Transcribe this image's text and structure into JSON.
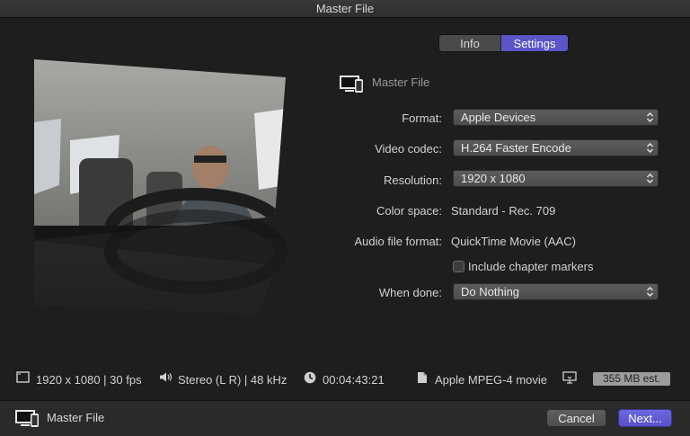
{
  "window": {
    "title": "Master File"
  },
  "tabs": [
    {
      "label": "Info",
      "selected": false
    },
    {
      "label": "Settings",
      "selected": true
    }
  ],
  "header": {
    "icon": "computer-and-phone-icon",
    "title": "Master File"
  },
  "settings": {
    "format": {
      "label": "Format:",
      "value": "Apple Devices"
    },
    "video_codec": {
      "label": "Video codec:",
      "value": "H.264 Faster Encode"
    },
    "resolution": {
      "label": "Resolution:",
      "value": "1920 x 1080"
    },
    "color_space": {
      "label": "Color space:",
      "value": "Standard - Rec. 709"
    },
    "audio_file_format": {
      "label": "Audio file format:",
      "value": "QuickTime Movie (AAC)"
    },
    "chapter_markers": {
      "label": "Include chapter markers",
      "checked": false
    },
    "when_done": {
      "label": "When done:",
      "value": "Do Nothing"
    }
  },
  "stats": {
    "video": "1920 x 1080 | 30 fps",
    "audio": "Stereo (L R) | 48 kHz",
    "duration": "00:04:43:21",
    "file_type": "Apple MPEG-4 movie",
    "size_estimate": "355 MB est."
  },
  "footer": {
    "title": "Master File",
    "cancel_label": "Cancel",
    "next_label": "Next..."
  },
  "colors": {
    "accent": "#5a55c8",
    "background": "#1e1e1e",
    "popup": "#555555"
  }
}
